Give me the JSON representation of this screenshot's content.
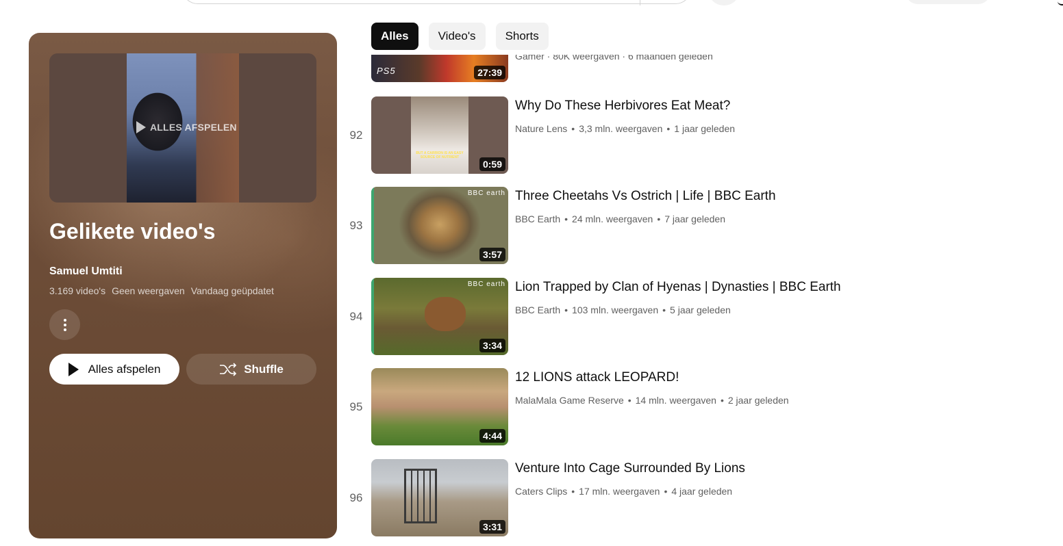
{
  "filters": [
    "Alles",
    "Video's",
    "Shorts"
  ],
  "playlist": {
    "title": "Gelikete video's",
    "owner": "Samuel Umtiti",
    "video_count": "3.169 video's",
    "views": "Geen weergaven",
    "updated": "Vandaag geüpdatet",
    "hero_overlay": "ALLES AFSPELEN",
    "play_all_label": "Alles afspelen",
    "shuffle_label": "Shuffle"
  },
  "partial_row": {
    "duration": "27:39",
    "badge": "PS5",
    "meta": "Gamer · 80K weergaven · 6 maanden geleden"
  },
  "videos": [
    {
      "index": "92",
      "title": "Why Do These Herbivores Eat Meat?",
      "channel": "Nature Lens",
      "views": "3,3 mln. weergaven",
      "age": "1 jaar geleden",
      "duration": "0:59",
      "caption": "BUT A CARRION IS AN EASY SOURCE OF NUTRIENT"
    },
    {
      "index": "93",
      "title": "Three Cheetahs Vs Ostrich | Life | BBC Earth",
      "channel": "BBC Earth",
      "views": "24 mln. weergaven",
      "age": "7 jaar geleden",
      "duration": "3:57",
      "badge": "BBC earth"
    },
    {
      "index": "94",
      "title": "Lion Trapped by Clan of Hyenas | Dynasties | BBC Earth",
      "channel": "BBC Earth",
      "views": "103 mln. weergaven",
      "age": "5 jaar geleden",
      "duration": "3:34",
      "badge": "BBC earth"
    },
    {
      "index": "95",
      "title": "12 LIONS attack LEOPARD!",
      "channel": "MalaMala Game Reserve",
      "views": "14 mln. weergaven",
      "age": "2 jaar geleden",
      "duration": "4:44"
    },
    {
      "index": "96",
      "title": "Venture Into Cage Surrounded By Lions",
      "channel": "Caters Clips",
      "views": "17 mln. weergaven",
      "age": "4 jaar geleden",
      "duration": "3:31"
    }
  ]
}
